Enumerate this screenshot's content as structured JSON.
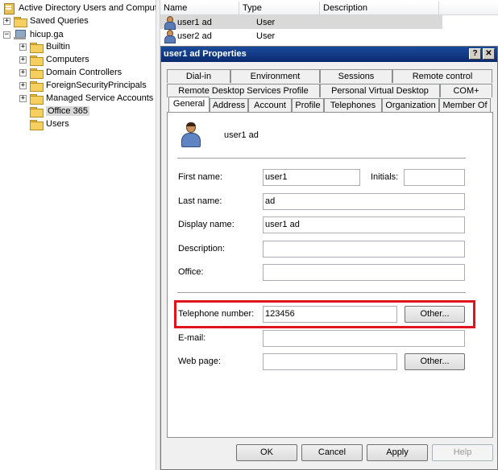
{
  "tree": {
    "root_label": "Active Directory Users and Comput",
    "saved_queries": "Saved Queries",
    "domain": "hicup.ga",
    "children": [
      "Builtin",
      "Computers",
      "Domain Controllers",
      "ForeignSecurityPrincipals",
      "Managed Service Accounts",
      "Office 365",
      "Users"
    ],
    "selected": "Office 365"
  },
  "list": {
    "columns": [
      "Name",
      "Type",
      "Description"
    ],
    "rows": [
      {
        "name": "user1 ad",
        "type": "User"
      },
      {
        "name": "user2 ad",
        "type": "User"
      }
    ]
  },
  "dialog": {
    "title": "user1 ad Properties",
    "help_glyph": "?",
    "close_glyph": "✕",
    "tabs_row1": [
      "Dial-in",
      "Environment",
      "Sessions",
      "Remote control"
    ],
    "tabs_row2": [
      "Remote Desktop Services Profile",
      "Personal Virtual Desktop",
      "COM+"
    ],
    "tabs_row3": [
      "General",
      "Address",
      "Account",
      "Profile",
      "Telephones",
      "Organization",
      "Member Of"
    ],
    "active_tab": "General",
    "display_header": "user1 ad",
    "fields": {
      "first_name_label": "First name:",
      "first_name": "user1",
      "initials_label": "Initials:",
      "initials": "",
      "last_name_label": "Last name:",
      "last_name": "ad",
      "display_name_label": "Display name:",
      "display_name": "user1 ad",
      "description_label": "Description:",
      "description": "",
      "office_label": "Office:",
      "office": "",
      "telephone_label": "Telephone number:",
      "telephone": "123456",
      "email_label": "E-mail:",
      "email": "",
      "webpage_label": "Web page:",
      "webpage": ""
    },
    "other_button": "Other...",
    "buttons": {
      "ok": "OK",
      "cancel": "Cancel",
      "apply": "Apply",
      "help": "Help"
    }
  },
  "colors": {
    "highlight": "#e0131e",
    "titlebar": "#0a2a6e"
  }
}
